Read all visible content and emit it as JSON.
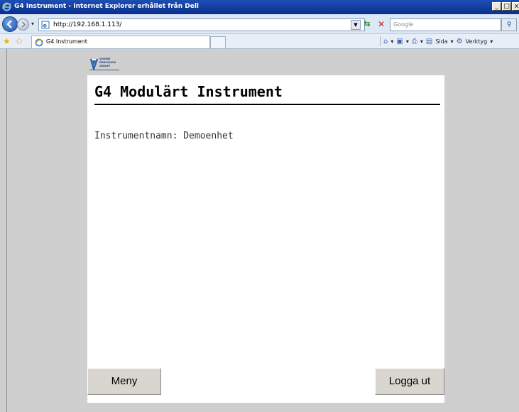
{
  "window": {
    "title": "G4 Instrument - Internet Explorer erhållet från Dell",
    "controls": {
      "minimize": "_",
      "maximize": "□",
      "close": "x"
    }
  },
  "addressbar": {
    "url": "http://192.168.1.113/",
    "search_placeholder": "Google"
  },
  "tabs": [
    {
      "label": "G4 Instrument"
    }
  ],
  "commandbar": {
    "page_label": "Sida",
    "tools_label": "Verktyg"
  },
  "logo": {
    "lines": [
      "VISHAY",
      "PRECISION",
      "GROUP"
    ]
  },
  "page": {
    "heading": "G4 Modulärt Instrument",
    "instrument_label": "Instrumentnamn:",
    "instrument_name": "Demoenhet",
    "menu_button": "Meny",
    "logout_button": "Logga ut"
  },
  "colors": {
    "titlebar": "#0a2f8c",
    "page_background": "#cfcfcf",
    "panel_background": "#ffffff",
    "button_face": "#d9d6cf"
  }
}
